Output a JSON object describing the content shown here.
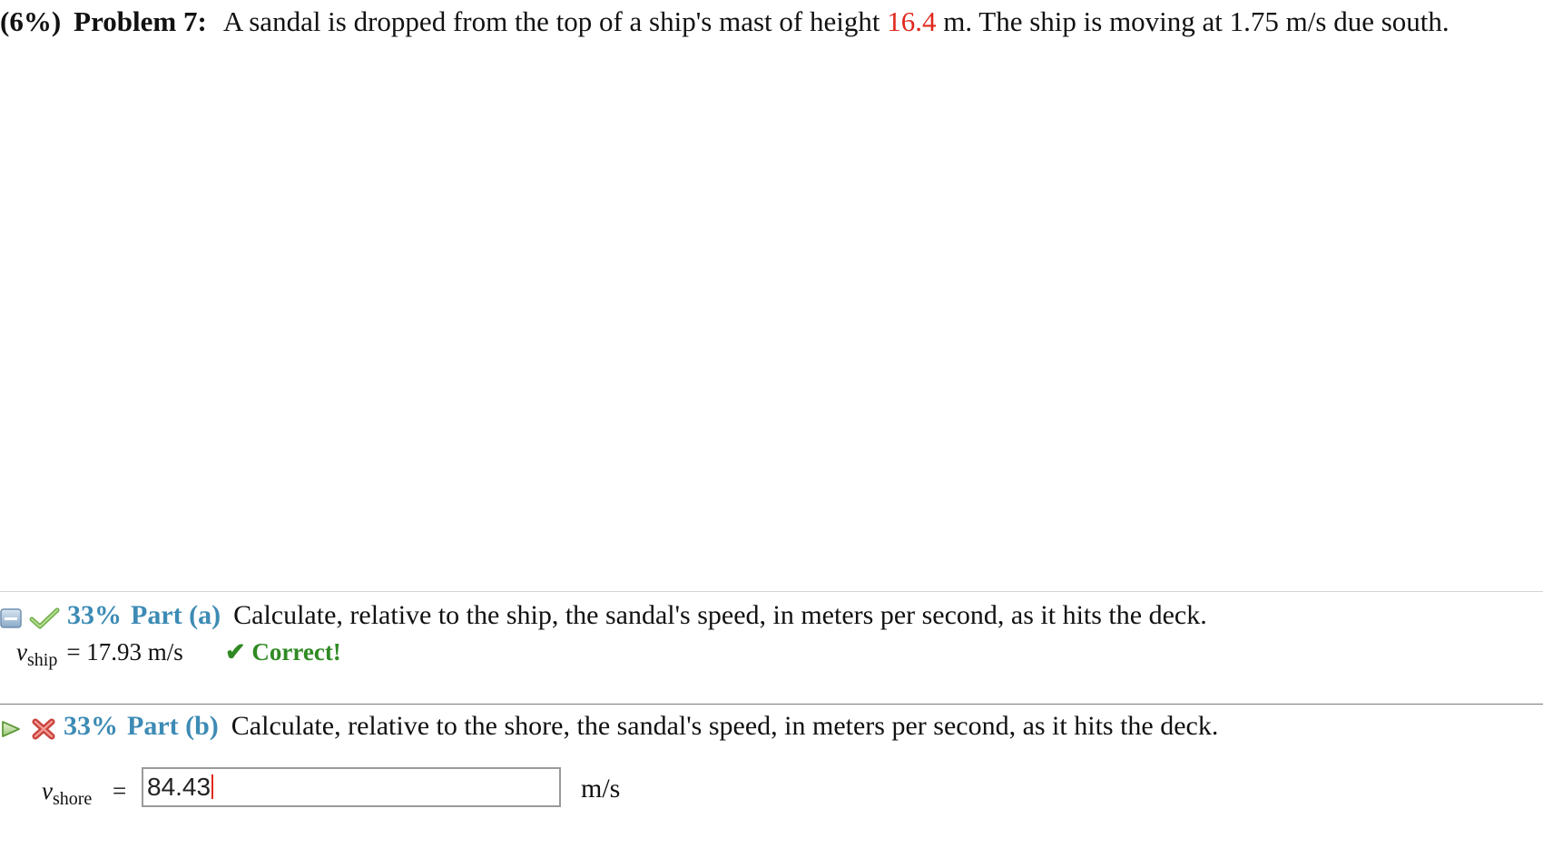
{
  "problem": {
    "weight": "(6%)",
    "label": "Problem 7:",
    "text_before": "A sandal is dropped from the top of a ship's mast of height ",
    "height_value": "16.4",
    "text_after": " m. The ship is moving at 1.75 m/s due south."
  },
  "part_a": {
    "percent": "33%",
    "label": "Part (a)",
    "question": "Calculate, relative to the ship, the sandal's speed, in meters per second, as it hits the deck.",
    "variable": "v",
    "subscript": "ship",
    "answer": "= 17.93 m/s",
    "feedback": "✔ Correct!",
    "icons": [
      "collapse-icon",
      "checkmark-icon"
    ]
  },
  "part_b": {
    "percent": "33%",
    "label": "Part (b)",
    "question": "Calculate, relative to the shore, the sandal's speed, in meters per second, as it hits the deck.",
    "variable": "v",
    "subscript": "shore",
    "equals": "=",
    "input_value": "84.43",
    "unit": "m/s",
    "icons": [
      "play-arrow-icon",
      "wrong-x-icon"
    ]
  },
  "colors": {
    "accent_blue": "#3d8bb5",
    "correct_green": "#2f8a23",
    "highlight_red": "#e0281e"
  }
}
